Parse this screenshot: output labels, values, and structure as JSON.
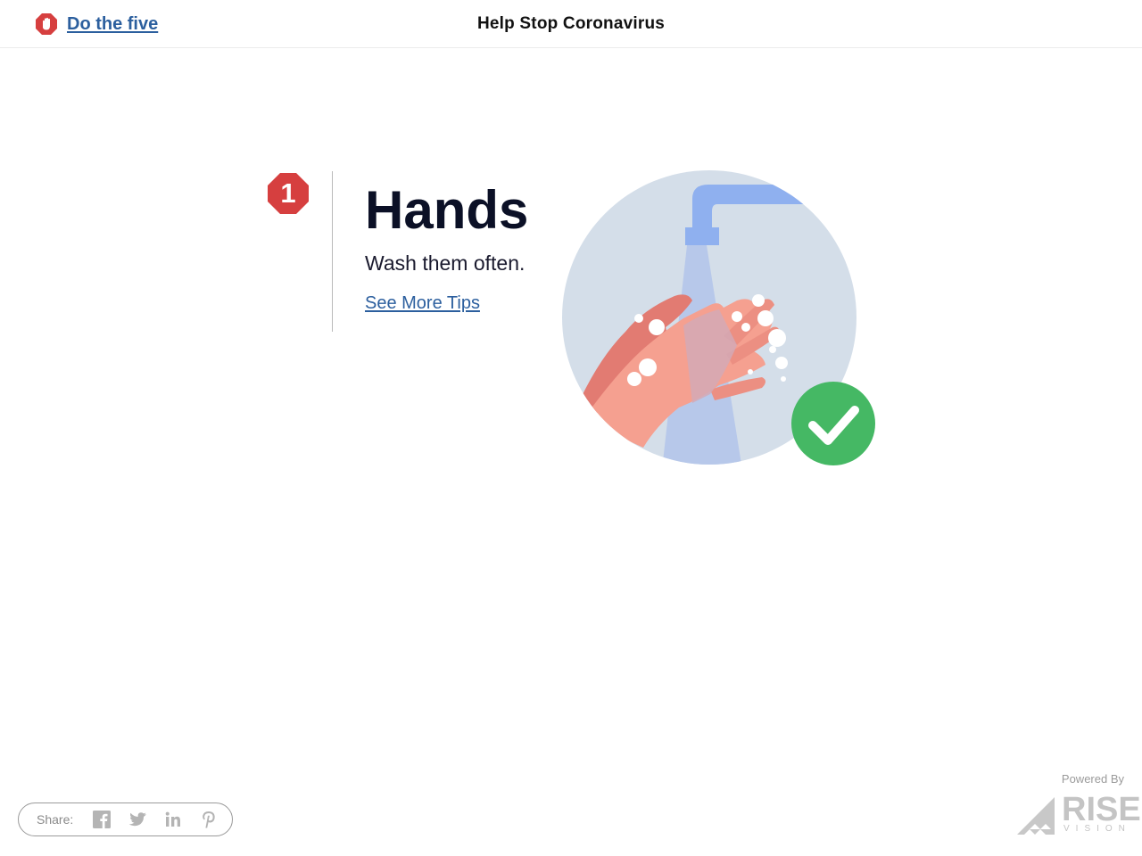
{
  "header": {
    "brand_link": "Do the five",
    "brand_icon": "stop-hand-icon",
    "title": "Help Stop Coronavirus"
  },
  "step": {
    "number": "1",
    "heading": "Hands",
    "subtitle": "Wash them often.",
    "link": "See More Tips",
    "illustration": "hand-washing-illustration",
    "check_icon": "check-circle-icon"
  },
  "share": {
    "label": "Share:",
    "icons": [
      "facebook-icon",
      "twitter-icon",
      "linkedin-icon",
      "pinterest-icon"
    ]
  },
  "footer": {
    "powered_by": "Powered By",
    "brand_word": "RISE",
    "brand_sub": "VISION"
  },
  "colors": {
    "accent_red": "#d63f3f",
    "link_blue": "#2c5f9e",
    "check_green": "#45b864",
    "circle_bg": "#d4dee9",
    "water_blue": "#b7c8ea",
    "faucet_blue": "#8fb0ef",
    "skin": "#f2998a"
  }
}
